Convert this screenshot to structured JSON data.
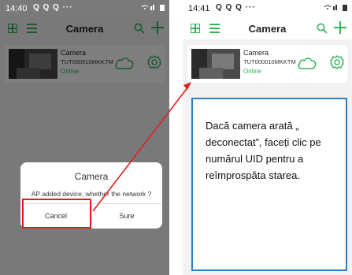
{
  "accent_color": "#35b35a",
  "left_screen": {
    "status_time": "14:40",
    "status_apps": "Q Q Q ···",
    "header_title": "Camera",
    "device": {
      "name": "Camera",
      "uid": "TUT000010MKKTM",
      "status": "Online"
    },
    "dialog": {
      "title": "Camera",
      "message": "AP added device, whether the network ?",
      "cancel_label": "Cancel",
      "sure_label": "Sure"
    }
  },
  "right_screen": {
    "status_time": "14:41",
    "status_apps": "Q Q Q ···",
    "header_title": "Camera",
    "device": {
      "name": "Camera",
      "uid": "TUT000010MKKTM",
      "status": "Online"
    }
  },
  "callout_text": "Dacă camera arată „ deconectat”, faceți clic pe numărul UID pentru a reîmprospăta starea.",
  "annotation_color": "#e02020",
  "callout_border_color": "#2a7fc5",
  "icons": [
    "grid-icon",
    "list-icon",
    "search-icon",
    "plus-icon",
    "cloud-icon",
    "gear-icon",
    "wifi-icon",
    "battery-icon"
  ]
}
